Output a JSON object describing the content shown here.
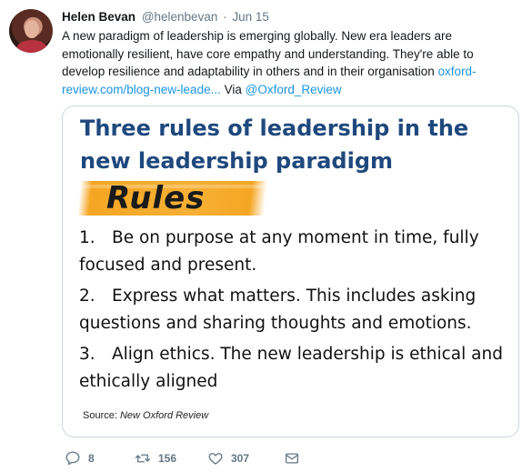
{
  "tweet": {
    "author_name": "Helen Bevan",
    "author_handle": "@helenbevan",
    "separator": "·",
    "date": "Jun 15",
    "text_main": "A new paradigm of leadership is emerging globally. New era leaders are emotionally resilient, have core empathy and understanding. They're able to develop resilience and adaptability in others and in their organisation",
    "link_text": "oxford-review.com/blog-new-leade...",
    "via_text": "Via",
    "via_mention": "@Oxford_Review"
  },
  "card": {
    "title": "Three rules of leadership in the new leadership paradigm",
    "banner_word": "Rules",
    "rules": [
      {
        "num": "1.",
        "text": "Be on purpose at any moment in time, fully focused and present."
      },
      {
        "num": "2.",
        "text": "Express what matters. This includes asking questions and sharing thoughts and emotions."
      },
      {
        "num": "3.",
        "text": "Align ethics. The new leadership is ethical and ethically aligned"
      }
    ],
    "source_label": "Source:",
    "source_name": "New Oxford Review"
  },
  "actions": {
    "reply_count": "8",
    "retweet_count": "156",
    "like_count": "307"
  },
  "colors": {
    "link": "#1b95e0",
    "card_title": "#1f497d",
    "banner": "#f5a623",
    "muted": "#657786"
  }
}
